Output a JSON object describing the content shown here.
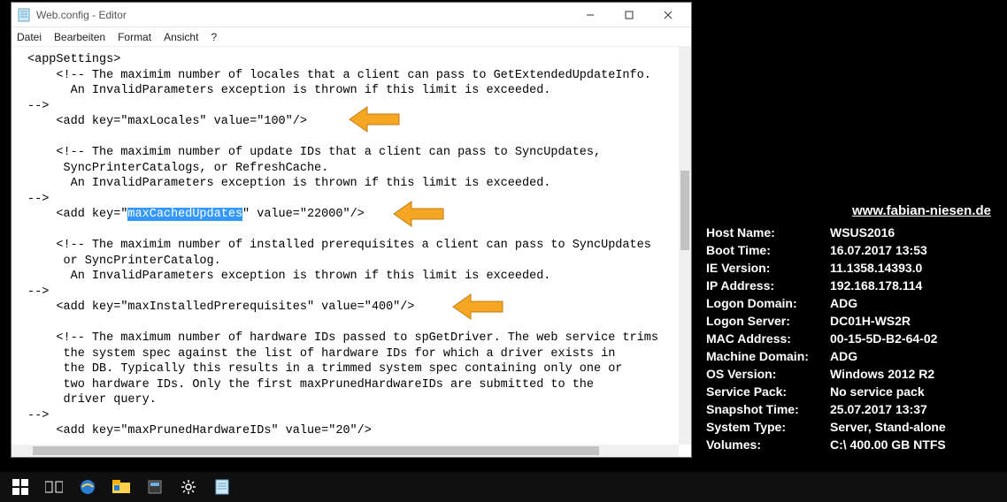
{
  "window": {
    "title": "Web.config - Editor"
  },
  "menu": {
    "file": "Datei",
    "edit": "Bearbeiten",
    "format": "Format",
    "view": "Ansicht",
    "help": "?"
  },
  "code": {
    "l01": "<appSettings>",
    "l02": "    <!-- The maximim number of locales that a client can pass to GetExtendedUpdateInfo.",
    "l03": "      An InvalidParameters exception is thrown if this limit is exceeded.",
    "l04": "-->",
    "l05": "    <add key=\"maxLocales\" value=\"100\"/>",
    "l06": "",
    "l07": "    <!-- The maximim number of update IDs that a client can pass to SyncUpdates,",
    "l08": "     SyncPrinterCatalogs, or RefreshCache.",
    "l09": "      An InvalidParameters exception is thrown if this limit is exceeded.",
    "l10": "-->",
    "l11a": "    <add key=\"",
    "l11b": "maxCachedUpdates",
    "l11c": "\" value=\"22000\"/>",
    "l12": "",
    "l13": "    <!-- The maximim number of installed prerequisites a client can pass to SyncUpdates",
    "l14": "     or SyncPrinterCatalog.",
    "l15": "      An InvalidParameters exception is thrown if this limit is exceeded.",
    "l16": "-->",
    "l17": "    <add key=\"maxInstalledPrerequisites\" value=\"400\"/>",
    "l18": "",
    "l19": "    <!-- The maximum number of hardware IDs passed to spGetDriver. The web service trims",
    "l20": "     the system spec against the list of hardware IDs for which a driver exists in",
    "l21": "     the DB. Typically this results in a trimmed system spec containing only one or",
    "l22": "     two hardware IDs. Only the first maxPrunedHardwareIDs are submitted to the",
    "l23": "     driver query.",
    "l24": "-->",
    "l25": "    <add key=\"maxPrunedHardwareIDs\" value=\"20\"/>"
  },
  "info": {
    "site": "www.fabian-niesen.de",
    "rows": [
      {
        "k": "Host Name:",
        "v": "WSUS2016"
      },
      {
        "k": "Boot Time:",
        "v": "16.07.2017 13:53"
      },
      {
        "k": "IE Version:",
        "v": "11.1358.14393.0"
      },
      {
        "k": "IP Address:",
        "v": "192.168.178.114"
      },
      {
        "k": "Logon Domain:",
        "v": "ADG"
      },
      {
        "k": "Logon Server:",
        "v": "DC01H-WS2R"
      },
      {
        "k": "MAC Address:",
        "v": "00-15-5D-B2-64-02"
      },
      {
        "k": "Machine Domain:",
        "v": "ADG"
      },
      {
        "k": "OS Version:",
        "v": "Windows 2012 R2"
      },
      {
        "k": "Service Pack:",
        "v": "No service pack"
      },
      {
        "k": "Snapshot Time:",
        "v": "25.07.2017 13:37"
      },
      {
        "k": "System Type:",
        "v": "Server, Stand-alone"
      },
      {
        "k": "Volumes:",
        "v": "C:\\ 400.00 GB NTFS"
      }
    ]
  }
}
